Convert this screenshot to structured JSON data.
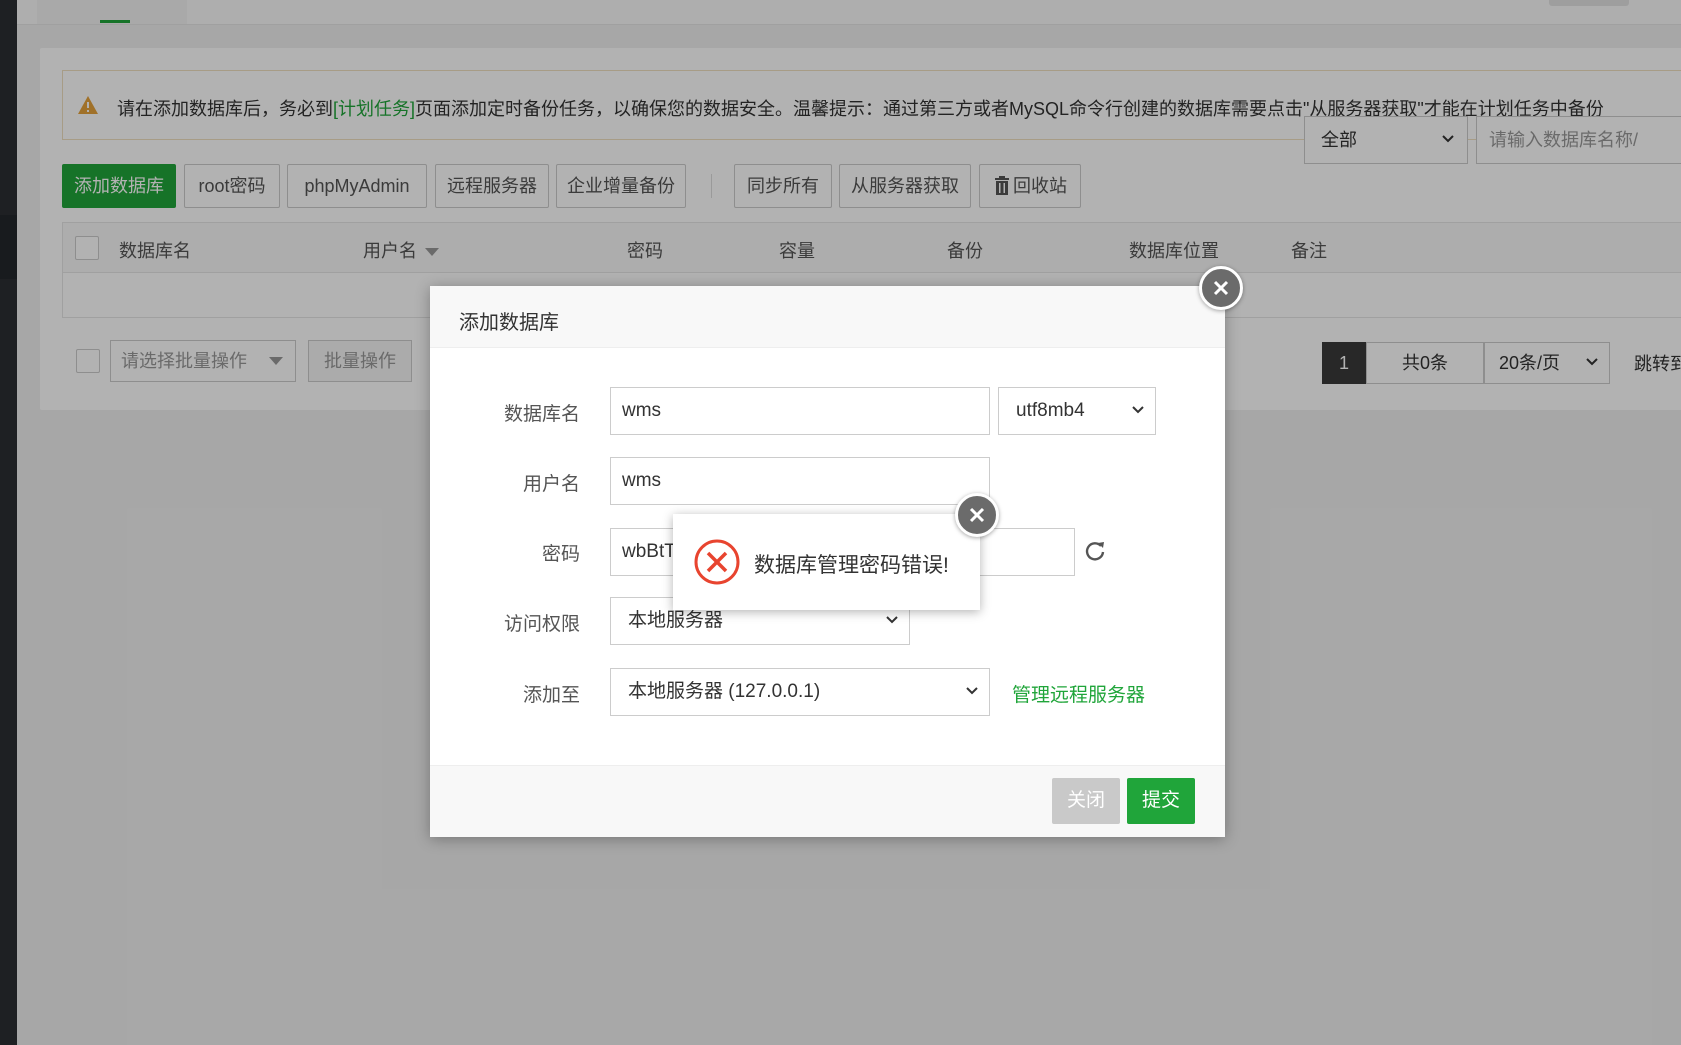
{
  "notice": {
    "text_before": "请在添加数据库后，务必到",
    "link": "[计划任务]",
    "text_after": "页面添加定时备份任务，以确保您的数据安全。温馨提示：通过第三方或者MySQL命令行创建的数据库需要点击\"从服务器获取\"才能在计划任务中备份"
  },
  "toolbar": {
    "add_db": "添加数据库",
    "root_pwd": "root密码",
    "phpmyadmin": "phpMyAdmin",
    "remote_server": "远程服务器",
    "enterprise_backup": "企业增量备份",
    "sync_all": "同步所有",
    "fetch_from_server": "从服务器获取",
    "recycle_bin": "回收站",
    "filter_value": "全部",
    "search_placeholder": "请输入数据库名称/"
  },
  "table": {
    "headers": [
      "数据库名",
      "用户名",
      "密码",
      "容量",
      "备份",
      "数据库位置",
      "备注"
    ]
  },
  "footer": {
    "batch_placeholder": "请选择批量操作",
    "batch_button": "批量操作",
    "current_page": "1",
    "total": "共0条",
    "page_size": "20条/页",
    "jump": "跳转到"
  },
  "dialog": {
    "title": "添加数据库",
    "db_name_label": "数据库名",
    "db_name_value": "wms",
    "charset_value": "utf8mb4",
    "username_label": "用户名",
    "username_value": "wms",
    "password_label": "密码",
    "password_value": "wbBtT",
    "access_label": "访问权限",
    "access_value": "本地服务器",
    "add_to_label": "添加至",
    "add_to_value": "本地服务器 (127.0.0.1)",
    "manage_remote_link": "管理远程服务器",
    "close_button": "关闭",
    "submit_button": "提交"
  },
  "toast": {
    "message": "数据库管理密码错误!"
  },
  "colors": {
    "accent": "#20a53a",
    "error": "#e8442f",
    "warning": "#e6a23c"
  }
}
